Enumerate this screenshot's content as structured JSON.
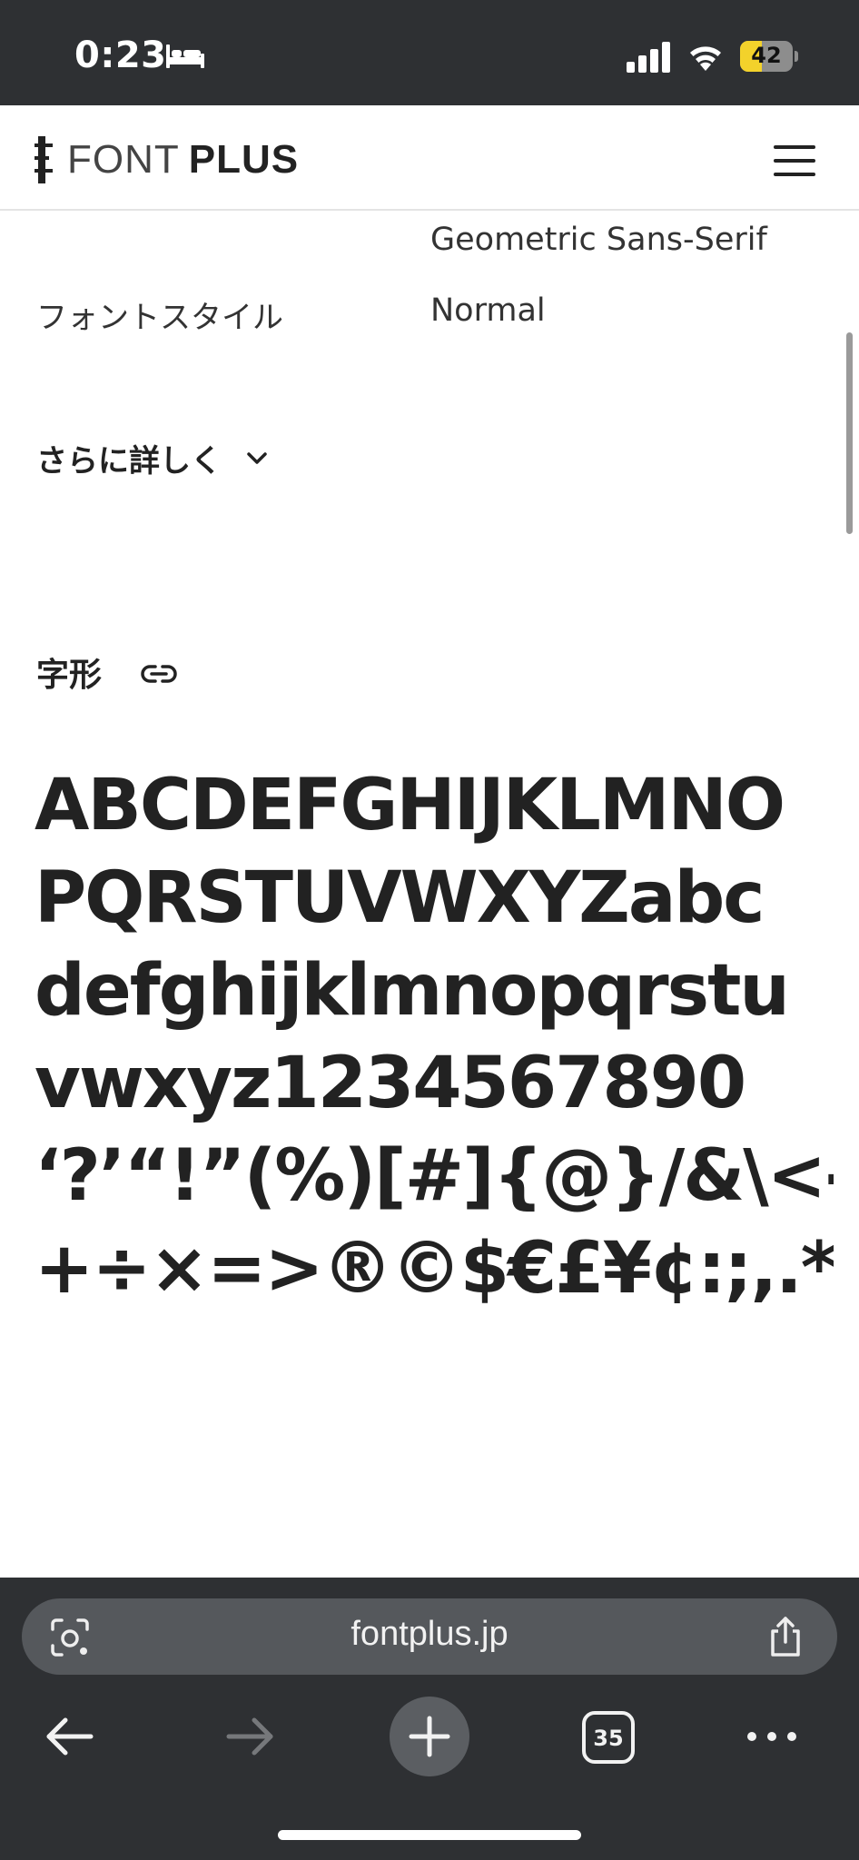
{
  "status_bar": {
    "time": "0:23",
    "battery_level": "42",
    "battery_fraction": 0.42,
    "icons": [
      "bed-icon",
      "signal-icon",
      "wifi-icon",
      "battery-charging-icon"
    ]
  },
  "header": {
    "logo_light": "FONT",
    "logo_bold": "PLUS",
    "menu_icon": "hamburger-menu-icon"
  },
  "properties": {
    "classification_value": "Geometric Sans-Serif",
    "font_style_label": "フォントスタイル",
    "font_style_value": "Normal",
    "more_label": "さらに詳しく"
  },
  "glyphs": {
    "heading": "字形",
    "lines": [
      "ABCDEFGHIJKLMNO",
      "PQRSTUVWXYZabc",
      "defghijklmnopqrstu",
      "vwxyz1234567890",
      "‘?’“!”(%)[#]{@}/&\\<-",
      "+÷×=>®©$€£¥¢:;,.*"
    ]
  },
  "browser": {
    "url": "fontplus.jp",
    "tab_count": "35"
  },
  "colors": {
    "chrome_dark": "#2e3033",
    "url_field": "#55585c",
    "battery_accent": "#f3d22b",
    "text": "#222222"
  }
}
